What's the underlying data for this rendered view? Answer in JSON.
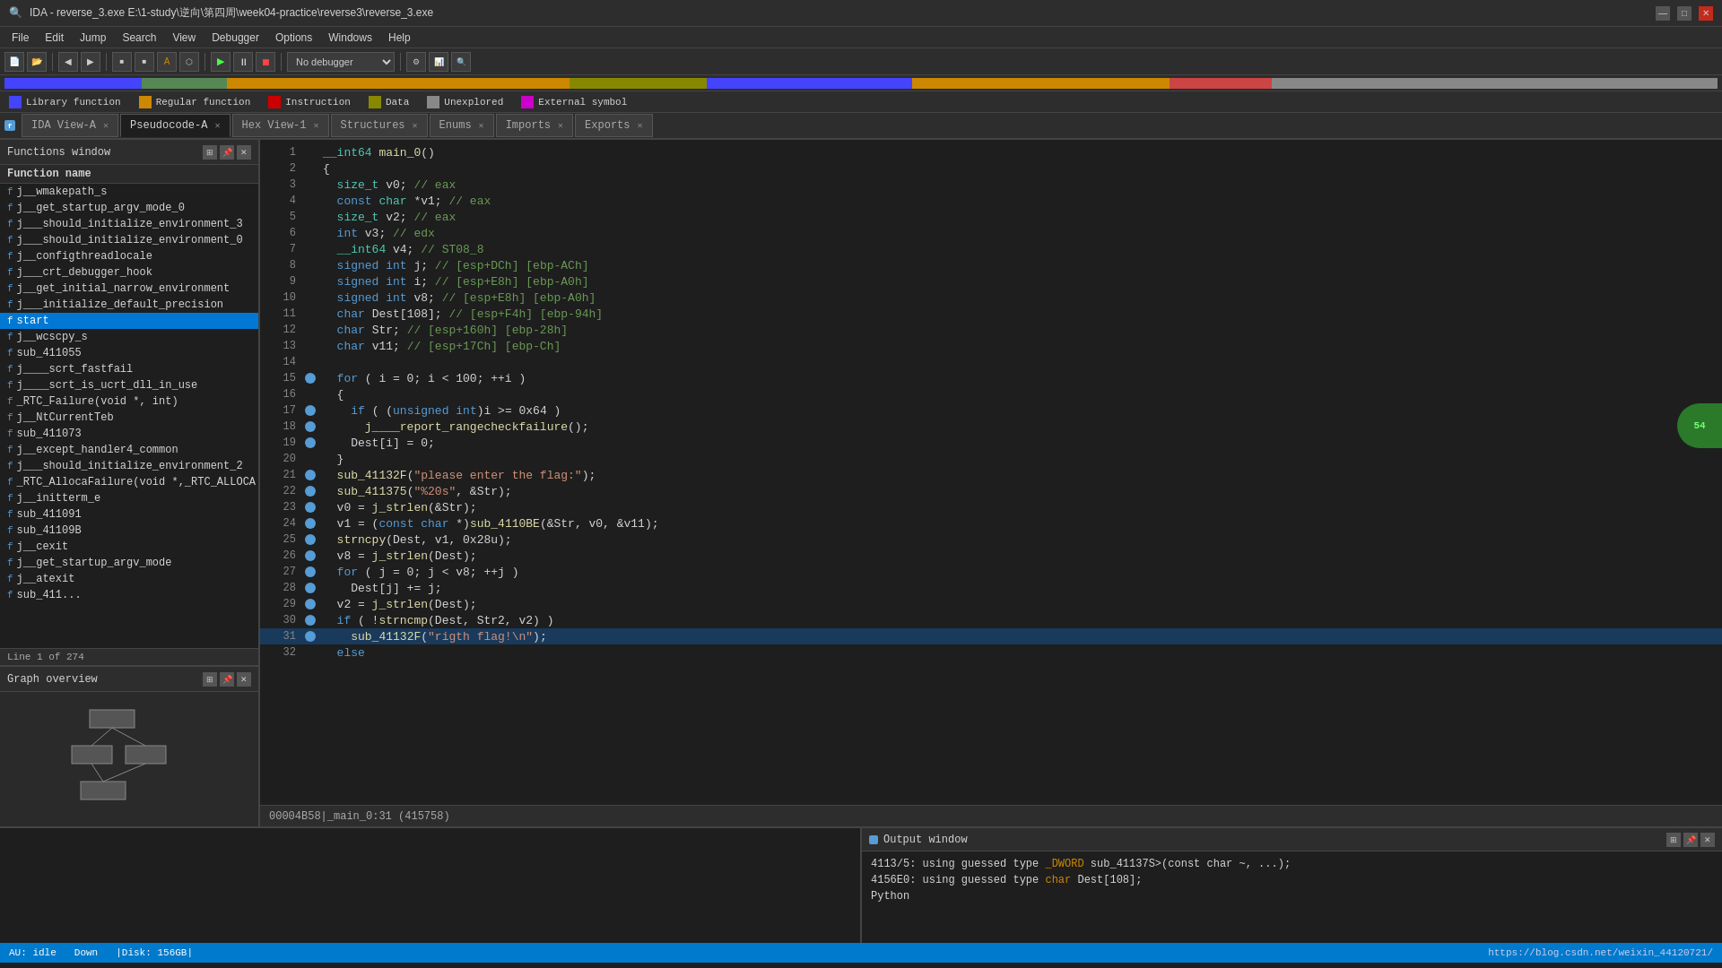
{
  "title": {
    "text": "IDA - reverse_3.exe E:\\1-study\\逆向\\第四周\\week04-practice\\reverse3\\reverse_3.exe",
    "icon": "ida-icon"
  },
  "window_controls": {
    "minimize": "—",
    "maximize": "□",
    "close": "✕"
  },
  "menu": {
    "items": [
      "File",
      "Edit",
      "Jump",
      "Search",
      "View",
      "Debugger",
      "Options",
      "Windows",
      "Help"
    ]
  },
  "tabs": [
    {
      "id": "ida-view-a",
      "label": "IDA View-A",
      "active": false,
      "closable": true
    },
    {
      "id": "pseudocode-a",
      "label": "Pseudocode-A",
      "active": true,
      "closable": true
    },
    {
      "id": "hex-view-1",
      "label": "Hex View-1",
      "active": false,
      "closable": true
    },
    {
      "id": "structures",
      "label": "Structures",
      "active": false,
      "closable": true
    },
    {
      "id": "enums",
      "label": "Enums",
      "active": false,
      "closable": true
    },
    {
      "id": "imports",
      "label": "Imports",
      "active": false,
      "closable": true
    },
    {
      "id": "exports",
      "label": "Exports",
      "active": false,
      "closable": true
    }
  ],
  "legend": [
    {
      "label": "Library function",
      "color": "#4444ff"
    },
    {
      "label": "Regular function",
      "color": "#cc8800"
    },
    {
      "label": "Instruction",
      "color": "#cc0000"
    },
    {
      "label": "Data",
      "color": "#888800"
    },
    {
      "label": "Unexplored",
      "color": "#888888"
    },
    {
      "label": "External symbol",
      "color": "#cc00cc"
    }
  ],
  "functions_panel": {
    "title": "Functions window",
    "column_header": "Function name",
    "status": "Line 1 of 274",
    "functions": [
      {
        "name": "j__wmakepath_s",
        "prefix": "f"
      },
      {
        "name": "j__get_startup_argv_mode_0",
        "prefix": "f"
      },
      {
        "name": "j___should_initialize_environment_3",
        "prefix": "f"
      },
      {
        "name": "j___should_initialize_environment_0",
        "prefix": "f"
      },
      {
        "name": "j__configthreadlocale",
        "prefix": "f"
      },
      {
        "name": "j___crt_debugger_hook",
        "prefix": "f"
      },
      {
        "name": "j__get_initial_narrow_environment",
        "prefix": "f"
      },
      {
        "name": "j___initialize_default_precision",
        "prefix": "f"
      },
      {
        "name": "start",
        "prefix": "f",
        "selected": true
      },
      {
        "name": "j__wcscpy_s",
        "prefix": "f"
      },
      {
        "name": "sub_411055",
        "prefix": "f"
      },
      {
        "name": "j____scrt_fastfail",
        "prefix": "f"
      },
      {
        "name": "j____scrt_is_ucrt_dll_in_use",
        "prefix": "f"
      },
      {
        "name": "_RTC_Failure(void *, int)",
        "prefix": "f"
      },
      {
        "name": "j__NtCurrentTeb",
        "prefix": "f"
      },
      {
        "name": "sub_411073",
        "prefix": "f"
      },
      {
        "name": "j__except_handler4_common",
        "prefix": "f"
      },
      {
        "name": "j___should_initialize_environment_2",
        "prefix": "f"
      },
      {
        "name": "_RTC_AllocaFailure(void *,_RTC_ALLOCA",
        "prefix": "f"
      },
      {
        "name": "j__initterm_e",
        "prefix": "f"
      },
      {
        "name": "sub_411091",
        "prefix": "f"
      },
      {
        "name": "sub_41109B",
        "prefix": "f"
      },
      {
        "name": "j__cexit",
        "prefix": "f"
      },
      {
        "name": "j__get_startup_argv_mode",
        "prefix": "f"
      },
      {
        "name": "j__atexit",
        "prefix": "f"
      },
      {
        "name": "sub_411...",
        "prefix": "f"
      }
    ]
  },
  "graph_overview": {
    "title": "Graph overview"
  },
  "code": {
    "title": "Pseudocode-A",
    "status": "00004B58|_main_0:31 (415758)",
    "lines": [
      {
        "num": 1,
        "has_dot": false,
        "text": "__int64 main_0()"
      },
      {
        "num": 2,
        "has_dot": false,
        "text": "{"
      },
      {
        "num": 3,
        "has_dot": false,
        "text": "  size_t v0; // eax"
      },
      {
        "num": 4,
        "has_dot": false,
        "text": "  const char *v1; // eax"
      },
      {
        "num": 5,
        "has_dot": false,
        "text": "  size_t v2; // eax"
      },
      {
        "num": 6,
        "has_dot": false,
        "text": "  int v3; // edx"
      },
      {
        "num": 7,
        "has_dot": false,
        "text": "  __int64 v4; // ST08_8"
      },
      {
        "num": 8,
        "has_dot": false,
        "text": "  signed int j; // [esp+DCh] [ebp-ACh]"
      },
      {
        "num": 9,
        "has_dot": false,
        "text": "  signed int i; // [esp+E8h] [ebp-A0h]"
      },
      {
        "num": 10,
        "has_dot": false,
        "text": "  signed int v8; // [esp+E8h] [ebp-A0h]"
      },
      {
        "num": 11,
        "has_dot": false,
        "text": "  char Dest[108]; // [esp+F4h] [ebp-94h]"
      },
      {
        "num": 12,
        "has_dot": false,
        "text": "  char Str; // [esp+160h] [ebp-28h]"
      },
      {
        "num": 13,
        "has_dot": false,
        "text": "  char v11; // [esp+17Ch] [ebp-Ch]"
      },
      {
        "num": 14,
        "has_dot": false,
        "text": ""
      },
      {
        "num": 15,
        "has_dot": true,
        "text": "  for ( i = 0; i < 100; ++i )"
      },
      {
        "num": 16,
        "has_dot": false,
        "text": "  {"
      },
      {
        "num": 17,
        "has_dot": true,
        "text": "    if ( (unsigned int)i >= 0x64 )"
      },
      {
        "num": 18,
        "has_dot": true,
        "text": "      j____report_rangecheckfailure();"
      },
      {
        "num": 19,
        "has_dot": true,
        "text": "    Dest[i] = 0;"
      },
      {
        "num": 20,
        "has_dot": false,
        "text": "  }"
      },
      {
        "num": 21,
        "has_dot": true,
        "text": "  sub_41132F(\"please enter the flag:\");"
      },
      {
        "num": 22,
        "has_dot": true,
        "text": "  sub_411375(\"%20s\", &Str);"
      },
      {
        "num": 23,
        "has_dot": true,
        "text": "  v0 = j_strlen(&Str);"
      },
      {
        "num": 24,
        "has_dot": true,
        "text": "  v1 = (const char *)sub_4110BE(&Str, v0, &v11);"
      },
      {
        "num": 25,
        "has_dot": true,
        "text": "  strncpy(Dest, v1, 0x28u);"
      },
      {
        "num": 26,
        "has_dot": true,
        "text": "  v8 = j_strlen(Dest);"
      },
      {
        "num": 27,
        "has_dot": true,
        "text": "  for ( j = 0; j < v8; ++j )"
      },
      {
        "num": 28,
        "has_dot": true,
        "text": "    Dest[j] += j;"
      },
      {
        "num": 29,
        "has_dot": true,
        "text": "  v2 = j_strlen(Dest);"
      },
      {
        "num": 30,
        "has_dot": true,
        "text": "  if ( !strncmp(Dest, Str2, v2) )"
      },
      {
        "num": 31,
        "has_dot": true,
        "text": "    sub_41132F(\"rigth flag!\\n\");",
        "highlighted": true
      },
      {
        "num": 32,
        "has_dot": false,
        "text": "  else"
      }
    ]
  },
  "output": {
    "title": "Output window",
    "lines": [
      "4113/5: using guessed type _DWORD sub_41137S>(const char ~, ...);",
      "4156E0: using guessed type char Dest[108];",
      "Python"
    ]
  },
  "status_bar": {
    "idle": "AU: idle",
    "down": "Down",
    "disk": "Disk: 156GB",
    "url": "https://blog.csdn.net/weixin_44120721/"
  },
  "green_circle": {
    "text": "54"
  },
  "debugger_select": {
    "value": "No debugger"
  },
  "progress_segments": [
    {
      "color": "#4444ff",
      "width": "8%"
    },
    {
      "color": "#888888",
      "width": "30%"
    },
    {
      "color": "#cc8800",
      "width": "15%"
    },
    {
      "color": "#888800",
      "width": "10%"
    },
    {
      "color": "#444488",
      "width": "8%"
    },
    {
      "color": "#cc8800",
      "width": "12%"
    },
    {
      "color": "#888888",
      "width": "17%"
    }
  ]
}
